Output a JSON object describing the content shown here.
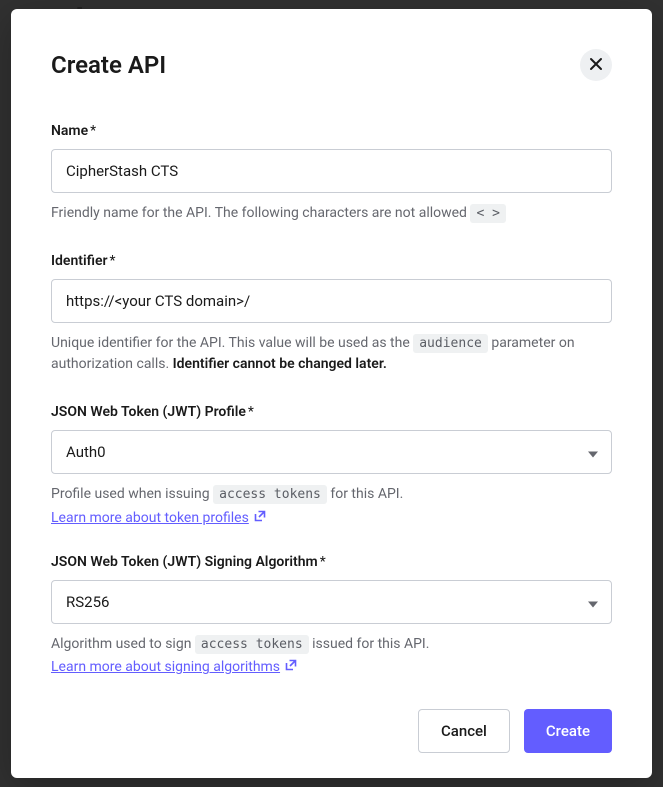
{
  "modal": {
    "title": "Create API",
    "fields": {
      "name": {
        "label": "Name",
        "value": "CipherStash CTS",
        "help_pre": "Friendly name for the API. The following characters are not allowed ",
        "help_code": "< >"
      },
      "identifier": {
        "label": "Identifier",
        "value": "https://<your CTS domain>/",
        "help_pre": "Unique identifier for the API. This value will be used as the ",
        "help_code": "audience",
        "help_mid": " parameter on authorization calls. ",
        "help_bold": "Identifier cannot be changed later."
      },
      "profile": {
        "label": "JSON Web Token (JWT) Profile",
        "value": "Auth0",
        "help_pre": "Profile used when issuing ",
        "help_code": "access tokens",
        "help_post": " for this API.",
        "link": "Learn more about token profiles"
      },
      "algorithm": {
        "label": "JSON Web Token (JWT) Signing Algorithm",
        "value": "RS256",
        "help_pre": "Algorithm used to sign ",
        "help_code": "access tokens",
        "help_post": " issued for this API.",
        "link": "Learn more about signing algorithms"
      }
    },
    "buttons": {
      "cancel": "Cancel",
      "create": "Create"
    }
  }
}
